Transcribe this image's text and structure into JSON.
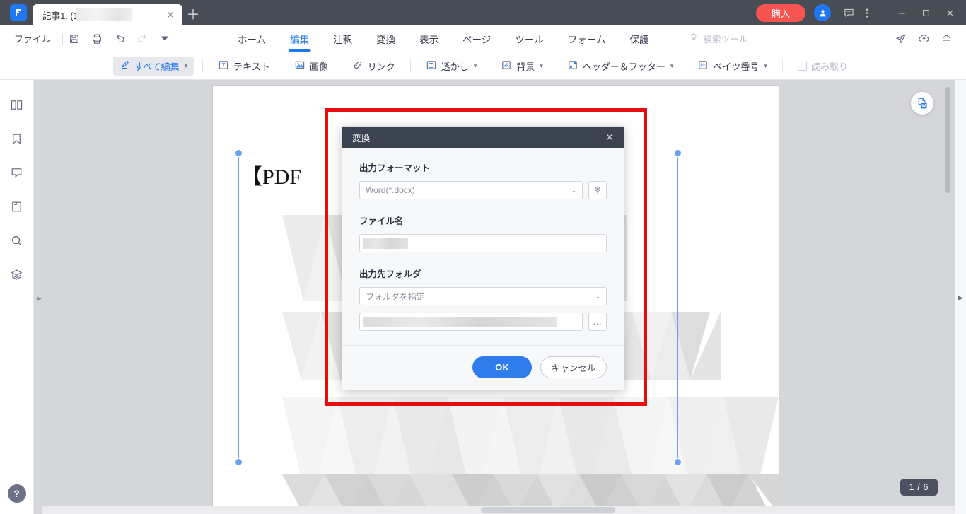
{
  "titlebar": {
    "logo_icon": "app-logo-icon",
    "tab_title": "記事1.                    (1).pdf *",
    "close_icon": "close-icon",
    "new_tab_icon": "plus-icon",
    "buy_label": "購入",
    "account_icon": "user-avatar-icon",
    "feedback_icon": "feedback-icon",
    "more_icon": "more-vertical-icon",
    "minimize_icon": "minimize-icon",
    "maximize_icon": "maximize-icon",
    "window_close_icon": "window-close-icon"
  },
  "menubar": {
    "file_label": "ファイル",
    "quick_icons": [
      "save-icon",
      "print-icon",
      "undo-icon",
      "redo-icon",
      "customize-dropdown-icon"
    ],
    "nav": [
      {
        "label": "ホーム",
        "active": false
      },
      {
        "label": "編集",
        "active": true
      },
      {
        "label": "注釈",
        "active": false
      },
      {
        "label": "変換",
        "active": false
      },
      {
        "label": "表示",
        "active": false
      },
      {
        "label": "ページ",
        "active": false
      },
      {
        "label": "ツール",
        "active": false
      },
      {
        "label": "フォーム",
        "active": false
      },
      {
        "label": "保護",
        "active": false
      }
    ],
    "search_tool_label": "検索ツール",
    "search_tool_icon": "lightbulb-icon",
    "right_icons": [
      "send-icon",
      "cloud-upload-icon",
      "share-icon"
    ]
  },
  "ribbon": {
    "edit_all_label": "すべて編集",
    "edit_all_icon": "pencil-edit-icon",
    "items": [
      {
        "label": "テキスト",
        "icon": "text-box-icon",
        "caret": false
      },
      {
        "label": "画像",
        "icon": "image-icon",
        "caret": false
      },
      {
        "label": "リンク",
        "icon": "link-icon",
        "caret": false
      },
      {
        "label": "透かし",
        "icon": "watermark-icon",
        "caret": true
      },
      {
        "label": "背景",
        "icon": "background-icon",
        "caret": true
      },
      {
        "label": "ヘッダー＆フッター",
        "icon": "header-footer-icon",
        "caret": true
      },
      {
        "label": "ベイツ番号",
        "icon": "bates-number-icon",
        "caret": true
      }
    ],
    "readonly_label": "読み取り",
    "readonly_checkbox_icon": "checkbox-unchecked-icon"
  },
  "leftrail": {
    "icons": [
      "thumbnails-panel-icon",
      "bookmarks-panel-icon",
      "comments-panel-icon",
      "attachments-panel-icon",
      "search-panel-icon",
      "layers-panel-icon"
    ],
    "help_icon": "help-question-icon",
    "expand_icon": "expand-right-icon"
  },
  "viewer": {
    "page_heading": "【PDF",
    "word_convert_icon": "word-convert-icon",
    "page_indicator": "1 / 6",
    "gutter_arrow_icon": "collapse-panel-icon"
  },
  "dialog": {
    "title": "変換",
    "close_icon": "dialog-close-icon",
    "format_label": "出力フォーマット",
    "format_value": "Word(*.docx)",
    "format_caret_icon": "chevron-down-icon",
    "format_settings_icon": "gear-settings-icon",
    "filename_label": "ファイル名",
    "filename_value": "",
    "folder_label": "出力先フォルダ",
    "folder_mode_value": "フォルダを指定",
    "folder_caret_icon": "chevron-down-icon",
    "folder_path_value": "",
    "browse_label": "...",
    "ok_label": "OK",
    "cancel_label": "キャンセル"
  },
  "colors": {
    "accent": "#2176f3",
    "buy": "#f7534f",
    "titlebar": "#474c55",
    "dialog_header": "#3c4350",
    "highlight_box": "#e60d0d",
    "ok_button": "#2f7ced"
  }
}
